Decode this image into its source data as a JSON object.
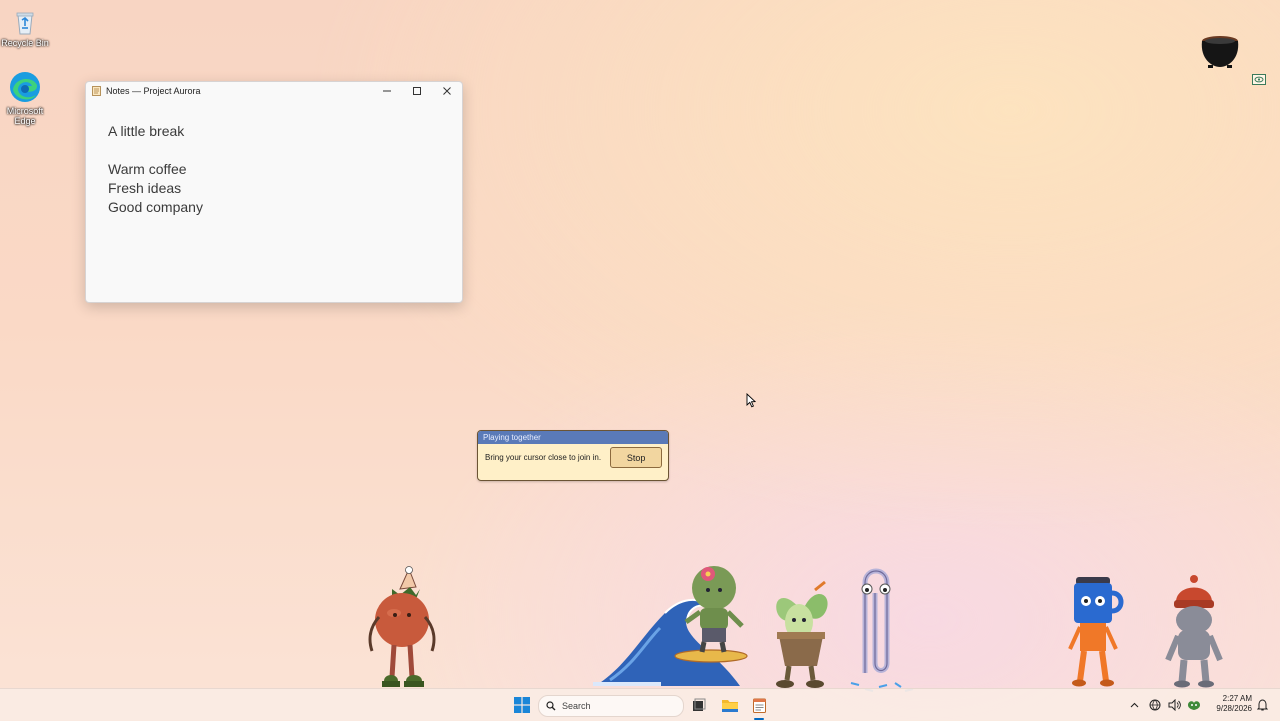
{
  "desktop": {
    "icons": [
      {
        "label": "Recycle Bin"
      },
      {
        "label": "Microsoft Edge"
      }
    ]
  },
  "notes_window": {
    "title": "Notes — Project Aurora",
    "lines": [
      "A little break",
      "",
      "Warm coffee",
      "Fresh ideas",
      "Good company"
    ]
  },
  "dialog": {
    "title": "Playing together",
    "message": "Bring your cursor close to join in.",
    "stop_label": "Stop"
  },
  "taskbar": {
    "search_placeholder": "Search",
    "time": "2:27 AM",
    "date": "9/28/2026",
    "icons": [
      "start-icon",
      "search-icon",
      "task-view-icon",
      "file-explorer-icon",
      "notepad-icon",
      "chevron-up-icon",
      "network-icon",
      "volume-icon",
      "battery-icon",
      "notification-icon"
    ]
  },
  "characters": [
    "tomato-character",
    "cactus-surfer-character",
    "wave",
    "sprout-pot-character",
    "paperclip-character",
    "coffee-cup-character",
    "beanie-character",
    "cauldron"
  ],
  "colors": {
    "titlebar_blue": "#5a7ab8",
    "dialog_bg": "#fff0c8",
    "accent": "#0067c0"
  }
}
